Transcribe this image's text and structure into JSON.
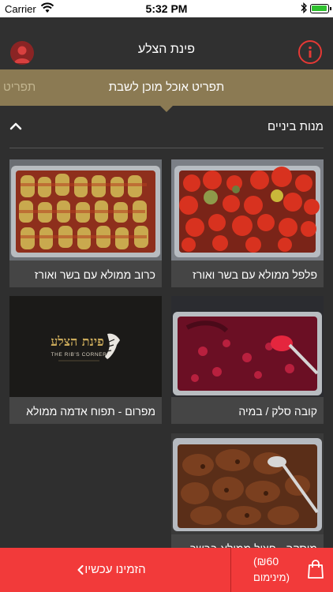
{
  "status_bar": {
    "carrier": "Carrier",
    "time": "5:32 PM"
  },
  "nav": {
    "title": "פינת הצלע"
  },
  "tabs": {
    "active": "תפריט אוכל מוכן לשבת",
    "next": "תפריט"
  },
  "section": {
    "title": "מנות ביניים"
  },
  "products": [
    {
      "name": "פלפל ממולא עם בשר ואורז",
      "image": "stuffed-peppers"
    },
    {
      "name": "כרוב ממולא עם בשר ואורז",
      "image": "stuffed-cabbage"
    },
    {
      "name": "קובה סלק / במיה",
      "image": "kubbeh-beet-soup"
    },
    {
      "name": "מפרום - תפוח אדמה ממולא",
      "image": "ribs-corner-logo"
    },
    {
      "name": "מוסקה - חציל ממולא בבשר",
      "image": "stuffed-eggplant"
    }
  ],
  "logo": {
    "hebrew": "פינת הצלע",
    "english": "THE RIB'S CORNER"
  },
  "bottom_bar": {
    "order_label": "הזמינו עכשיו",
    "price": "(₪60",
    "minimum": "מינימום)"
  },
  "colors": {
    "accent_red": "#f23a3a",
    "gold": "#8b7a53",
    "background": "#2f2f2f"
  }
}
